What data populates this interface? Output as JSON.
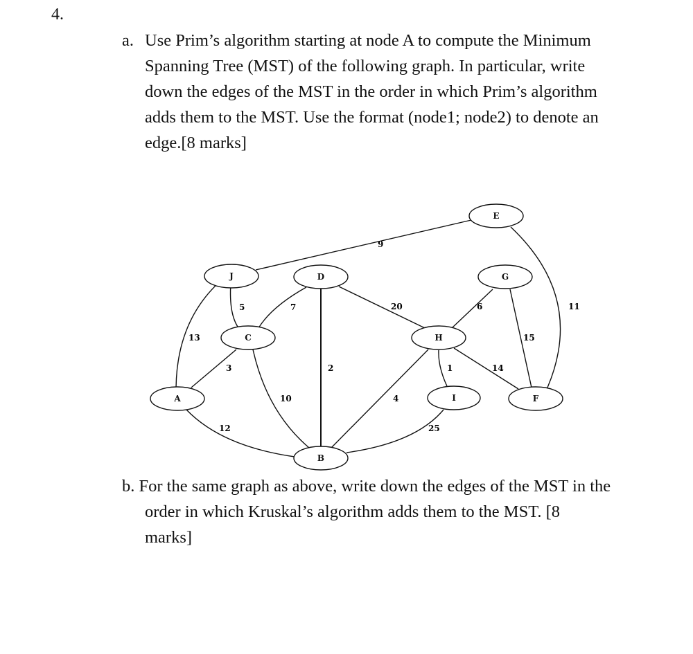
{
  "question_number": "4.",
  "part_a": {
    "marker": "a.",
    "lines": [
      "Use Prim’s algorithm starting at node A to compute the Minimum",
      "Spanning Tree (MST) of the following graph. In particular, write",
      "down the edges of the MST in the order in which Prim’s algorithm",
      "adds them to the MST. Use the format (node1; node2) to denote an",
      "edge.[8 marks]"
    ]
  },
  "graph": {
    "nodes": [
      {
        "id": "A",
        "label": "A"
      },
      {
        "id": "B",
        "label": "B"
      },
      {
        "id": "C",
        "label": "C"
      },
      {
        "id": "D",
        "label": "D"
      },
      {
        "id": "E",
        "label": "E"
      },
      {
        "id": "F",
        "label": "F"
      },
      {
        "id": "G",
        "label": "G"
      },
      {
        "id": "H",
        "label": "H"
      },
      {
        "id": "I",
        "label": "I"
      },
      {
        "id": "J",
        "label": "J"
      }
    ],
    "edges": [
      {
        "from": "J",
        "to": "E",
        "weight": "9"
      },
      {
        "from": "J",
        "to": "C",
        "weight": "5"
      },
      {
        "from": "J",
        "to": "A",
        "weight": "13"
      },
      {
        "from": "D",
        "to": "C",
        "weight": "7"
      },
      {
        "from": "D",
        "to": "B",
        "weight": "2"
      },
      {
        "from": "D",
        "to": "H",
        "weight": "20"
      },
      {
        "from": "G",
        "to": "H",
        "weight": "6"
      },
      {
        "from": "G",
        "to": "F",
        "weight": "15"
      },
      {
        "from": "E",
        "to": "F",
        "weight": "11"
      },
      {
        "from": "C",
        "to": "A",
        "weight": "3"
      },
      {
        "from": "C",
        "to": "B",
        "weight": "10"
      },
      {
        "from": "A",
        "to": "B",
        "weight": "12"
      },
      {
        "from": "H",
        "to": "B",
        "weight": "4"
      },
      {
        "from": "H",
        "to": "I",
        "weight": "1"
      },
      {
        "from": "H",
        "to": "F",
        "weight": "14"
      },
      {
        "from": "I",
        "to": "B",
        "weight": "25"
      }
    ]
  },
  "part_b": {
    "marker": "b.",
    "lines": [
      "For the same graph as above, write down the edges of the MST in the",
      "order in which Kruskal’s algorithm adds them to the MST. [8",
      "marks]"
    ]
  }
}
